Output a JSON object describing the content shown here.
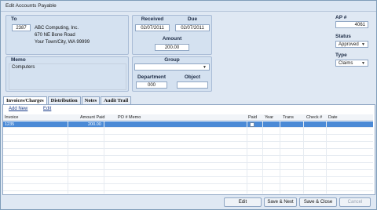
{
  "window": {
    "title": "Edit Accounts Payable"
  },
  "to": {
    "label": "To",
    "vendor_id": "2387",
    "name": "ABC Computing, Inc.",
    "address1": "670 NE Bone Road",
    "address2": "Your Town/City, WA 99999"
  },
  "received": {
    "label": "Received",
    "value": "02/07/2011"
  },
  "due": {
    "label": "Due",
    "value": "02/07/2011"
  },
  "amount": {
    "label": "Amount",
    "value": "200.00"
  },
  "memo": {
    "label": "Memo",
    "value": "Computers"
  },
  "group": {
    "label": "Group",
    "value": ""
  },
  "department": {
    "label": "Department",
    "value": "000"
  },
  "object": {
    "label": "Object",
    "value": ""
  },
  "ap": {
    "label": "AP #",
    "value": "4061"
  },
  "status": {
    "label": "Status",
    "value": "Approved"
  },
  "type": {
    "label": "Type",
    "value": "Claims"
  },
  "tabs": [
    {
      "label": "Invoices/Charges"
    },
    {
      "label": "Distribution"
    },
    {
      "label": "Notes"
    },
    {
      "label": "Audit Trail"
    }
  ],
  "toolbar": {
    "add_new": "Add New",
    "edit": "Edit"
  },
  "grid": {
    "columns": [
      "Invoice",
      "Amount Paid",
      "PO #",
      "Memo",
      "Paid",
      "Year",
      "Trans",
      "Check #",
      "Date"
    ],
    "rows": [
      {
        "invoice": "1235",
        "amount_paid": "200.00",
        "po": "",
        "memo": "",
        "year": "",
        "trans": "",
        "check": "",
        "date": ""
      }
    ]
  },
  "buttons": {
    "edit": "Edit",
    "save_next": "Save & Next",
    "save_close": "Save & Close",
    "cancel": "Cancel"
  }
}
